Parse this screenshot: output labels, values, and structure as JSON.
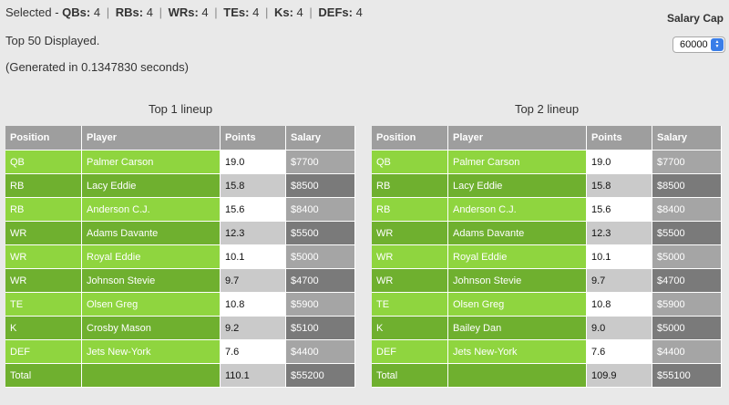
{
  "summary": {
    "prefix": "Selected -",
    "counts": [
      {
        "label": "QBs:",
        "value": "4"
      },
      {
        "label": "RBs:",
        "value": "4"
      },
      {
        "label": "WRs:",
        "value": "4"
      },
      {
        "label": "TEs:",
        "value": "4"
      },
      {
        "label": "Ks:",
        "value": "4"
      },
      {
        "label": "DEFs:",
        "value": "4"
      }
    ],
    "separator": "|"
  },
  "displayed_text": "Top 50 Displayed.",
  "generated_text": "(Generated in 0.1347830 seconds)",
  "salary_cap": {
    "label": "Salary Cap",
    "selected_value": "60000"
  },
  "columns": [
    "Position",
    "Player",
    "Points",
    "Salary"
  ],
  "lineups": [
    {
      "title": "Top 1 lineup",
      "rows": [
        {
          "position": "QB",
          "player": "Palmer Carson",
          "points": "19.0",
          "salary": "$7700"
        },
        {
          "position": "RB",
          "player": "Lacy Eddie",
          "points": "15.8",
          "salary": "$8500"
        },
        {
          "position": "RB",
          "player": "Anderson C.J.",
          "points": "15.6",
          "salary": "$8400"
        },
        {
          "position": "WR",
          "player": "Adams Davante",
          "points": "12.3",
          "salary": "$5500"
        },
        {
          "position": "WR",
          "player": "Royal Eddie",
          "points": "10.1",
          "salary": "$5000"
        },
        {
          "position": "WR",
          "player": "Johnson Stevie",
          "points": "9.7",
          "salary": "$4700"
        },
        {
          "position": "TE",
          "player": "Olsen Greg",
          "points": "10.8",
          "salary": "$5900"
        },
        {
          "position": "K",
          "player": "Crosby Mason",
          "points": "9.2",
          "salary": "$5100"
        },
        {
          "position": "DEF",
          "player": "Jets New-York",
          "points": "7.6",
          "salary": "$4400"
        }
      ],
      "total": {
        "label": "Total",
        "points": "110.1",
        "salary": "$55200"
      }
    },
    {
      "title": "Top 2 lineup",
      "rows": [
        {
          "position": "QB",
          "player": "Palmer Carson",
          "points": "19.0",
          "salary": "$7700"
        },
        {
          "position": "RB",
          "player": "Lacy Eddie",
          "points": "15.8",
          "salary": "$8500"
        },
        {
          "position": "RB",
          "player": "Anderson C.J.",
          "points": "15.6",
          "salary": "$8400"
        },
        {
          "position": "WR",
          "player": "Adams Davante",
          "points": "12.3",
          "salary": "$5500"
        },
        {
          "position": "WR",
          "player": "Royal Eddie",
          "points": "10.1",
          "salary": "$5000"
        },
        {
          "position": "WR",
          "player": "Johnson Stevie",
          "points": "9.7",
          "salary": "$4700"
        },
        {
          "position": "TE",
          "player": "Olsen Greg",
          "points": "10.8",
          "salary": "$5900"
        },
        {
          "position": "K",
          "player": "Bailey Dan",
          "points": "9.0",
          "salary": "$5000"
        },
        {
          "position": "DEF",
          "player": "Jets New-York",
          "points": "7.6",
          "salary": "$4400"
        }
      ],
      "total": {
        "label": "Total",
        "points": "109.9",
        "salary": "$55100"
      }
    }
  ],
  "colors": {
    "row_green_light": "#8fd53f",
    "row_green_dark": "#6fb02f",
    "header_gray": "#9e9e9e",
    "select_accent": "#3a7ee8"
  }
}
